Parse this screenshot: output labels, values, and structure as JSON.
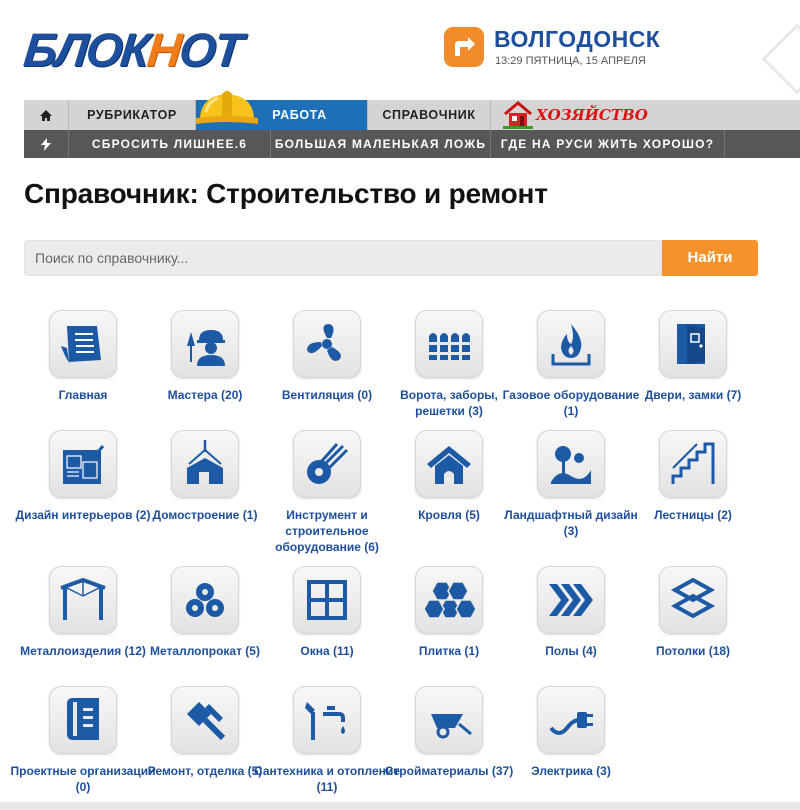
{
  "header": {
    "logo_text_a": "БЛОК",
    "logo_text_b": "Н",
    "logo_text_c": "ОТ",
    "city": "ВОЛГОДОНСК",
    "datetime": "13:29 ПЯТНИЦА, 15 АПРЕЛЯ"
  },
  "nav_main": {
    "home_icon": "home-icon",
    "items": [
      "РУБРИКАТОР",
      "РАБОТА",
      "СПРАВОЧНИК"
    ],
    "hoz_label": "Хозяйство"
  },
  "nav_news": {
    "icon": "lightning-icon",
    "items": [
      "СБРОСИТЬ ЛИШНЕЕ.6",
      "БОЛЬШАЯ МАЛЕНЬКАЯ ЛОЖЬ",
      "ГДЕ НА РУСИ ЖИТЬ ХОРОШО?"
    ]
  },
  "page": {
    "title": "Справочник: Строительство и ремонт"
  },
  "search": {
    "placeholder": "Поиск по справочнику...",
    "button": "Найти"
  },
  "categories": [
    {
      "label": "Главная",
      "icon": "document-icon"
    },
    {
      "label": "Мастера (20)",
      "icon": "worker-icon"
    },
    {
      "label": "Вентиляция (0)",
      "icon": "fan-icon"
    },
    {
      "label": "Ворота, заборы, решетки (3)",
      "icon": "fence-icon"
    },
    {
      "label": "Газовое оборудование (1)",
      "icon": "gas-flame-icon"
    },
    {
      "label": "Двери, замки (7)",
      "icon": "door-icon"
    },
    {
      "label": "Дизайн интерьеров (2)",
      "icon": "blueprint-icon"
    },
    {
      "label": "Домостроение (1)",
      "icon": "crane-house-icon"
    },
    {
      "label": "Инструмент и строительное оборудование (6)",
      "icon": "saw-icon"
    },
    {
      "label": "Кровля (5)",
      "icon": "roof-icon"
    },
    {
      "label": "Ландшафтный дизайн (3)",
      "icon": "landscape-icon"
    },
    {
      "label": "Лестницы (2)",
      "icon": "stairs-icon"
    },
    {
      "label": "Металлоизделия (12)",
      "icon": "metal-frame-icon"
    },
    {
      "label": "Металлопрокат (5)",
      "icon": "pipes-icon"
    },
    {
      "label": "Окна (11)",
      "icon": "window-icon"
    },
    {
      "label": "Плитка (1)",
      "icon": "tile-icon"
    },
    {
      "label": "Полы (4)",
      "icon": "floor-icon"
    },
    {
      "label": "Потолки (18)",
      "icon": "ceiling-icon"
    },
    {
      "label": "Проектные организации (0)",
      "icon": "project-icon"
    },
    {
      "label": "Ремонт, отделка (5)",
      "icon": "paint-brush-icon"
    },
    {
      "label": "Сантехника и отопление (11)",
      "icon": "faucet-icon"
    },
    {
      "label": "Стройматериалы (37)",
      "icon": "wheelbarrow-icon"
    },
    {
      "label": "Электрика (3)",
      "icon": "plug-icon"
    }
  ],
  "colors": {
    "brand_blue": "#1d4f9c",
    "accent_orange": "#f5932a",
    "active_tab": "#1d6fb8"
  }
}
